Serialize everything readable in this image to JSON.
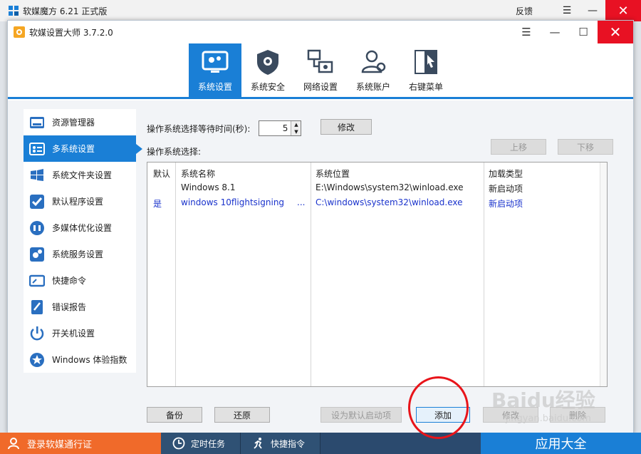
{
  "outer_window": {
    "title": "软媒魔方 6.21 正式版",
    "feedback": "反馈"
  },
  "dialog": {
    "title": "软媒设置大师 3.7.2.0"
  },
  "toolbar": {
    "tabs": [
      {
        "label": "系统设置",
        "icon": "system-settings-icon",
        "active": true
      },
      {
        "label": "系统安全",
        "icon": "shield-icon",
        "active": false
      },
      {
        "label": "网络设置",
        "icon": "network-icon",
        "active": false
      },
      {
        "label": "系统账户",
        "icon": "users-icon",
        "active": false
      },
      {
        "label": "右键菜单",
        "icon": "context-menu-icon",
        "active": false
      }
    ]
  },
  "sidebar": {
    "items": [
      {
        "label": "资源管理器",
        "icon": "explorer-icon"
      },
      {
        "label": "多系统设置",
        "icon": "multi-system-icon",
        "active": true
      },
      {
        "label": "系统文件夹设置",
        "icon": "windows-folder-icon"
      },
      {
        "label": "默认程序设置",
        "icon": "default-program-icon"
      },
      {
        "label": "多媒体优化设置",
        "icon": "multimedia-icon"
      },
      {
        "label": "系统服务设置",
        "icon": "service-gear-icon"
      },
      {
        "label": "快捷命令",
        "icon": "shortcut-command-icon"
      },
      {
        "label": "错误报告",
        "icon": "error-report-icon"
      },
      {
        "label": "开关机设置",
        "icon": "power-icon"
      },
      {
        "label": "Windows 体验指数",
        "icon": "windows-rating-icon"
      }
    ]
  },
  "main": {
    "wait_label": "操作系统选择等待时间(秒):",
    "wait_value": "5",
    "modify_btn": "修改",
    "select_label": "操作系统选择:",
    "move_up": "上移",
    "move_down": "下移",
    "columns": [
      "默认",
      "系统名称",
      "系统位置",
      "加载类型"
    ],
    "rows": [
      [
        "",
        "Windows 8.1",
        "E:\\Windows\\system32\\winload.exe",
        "新启动项"
      ],
      [
        "是",
        "windows 10flightsigning",
        "C:\\windows\\system32\\winload.exe",
        "新启动项"
      ]
    ],
    "row2_ellipsis": "...",
    "backup_btn": "备份",
    "restore_btn": "还原",
    "set_default_btn": "设为默认启动项",
    "add_btn": "添加",
    "edit_btn": "修改",
    "delete_btn": "删除"
  },
  "bottombar": {
    "login": "登录软媒通行证",
    "scheduled": "定时任务",
    "quick_cmd": "快捷指令",
    "apps": "应用大全"
  },
  "watermark": {
    "brand": "Baidu经验",
    "url": "jingyan.baidu.com"
  },
  "colors": {
    "accent": "#1a7fd6",
    "close_red": "#e81123",
    "login_orange": "#f06a2a",
    "annotation_red": "#e8141a"
  }
}
